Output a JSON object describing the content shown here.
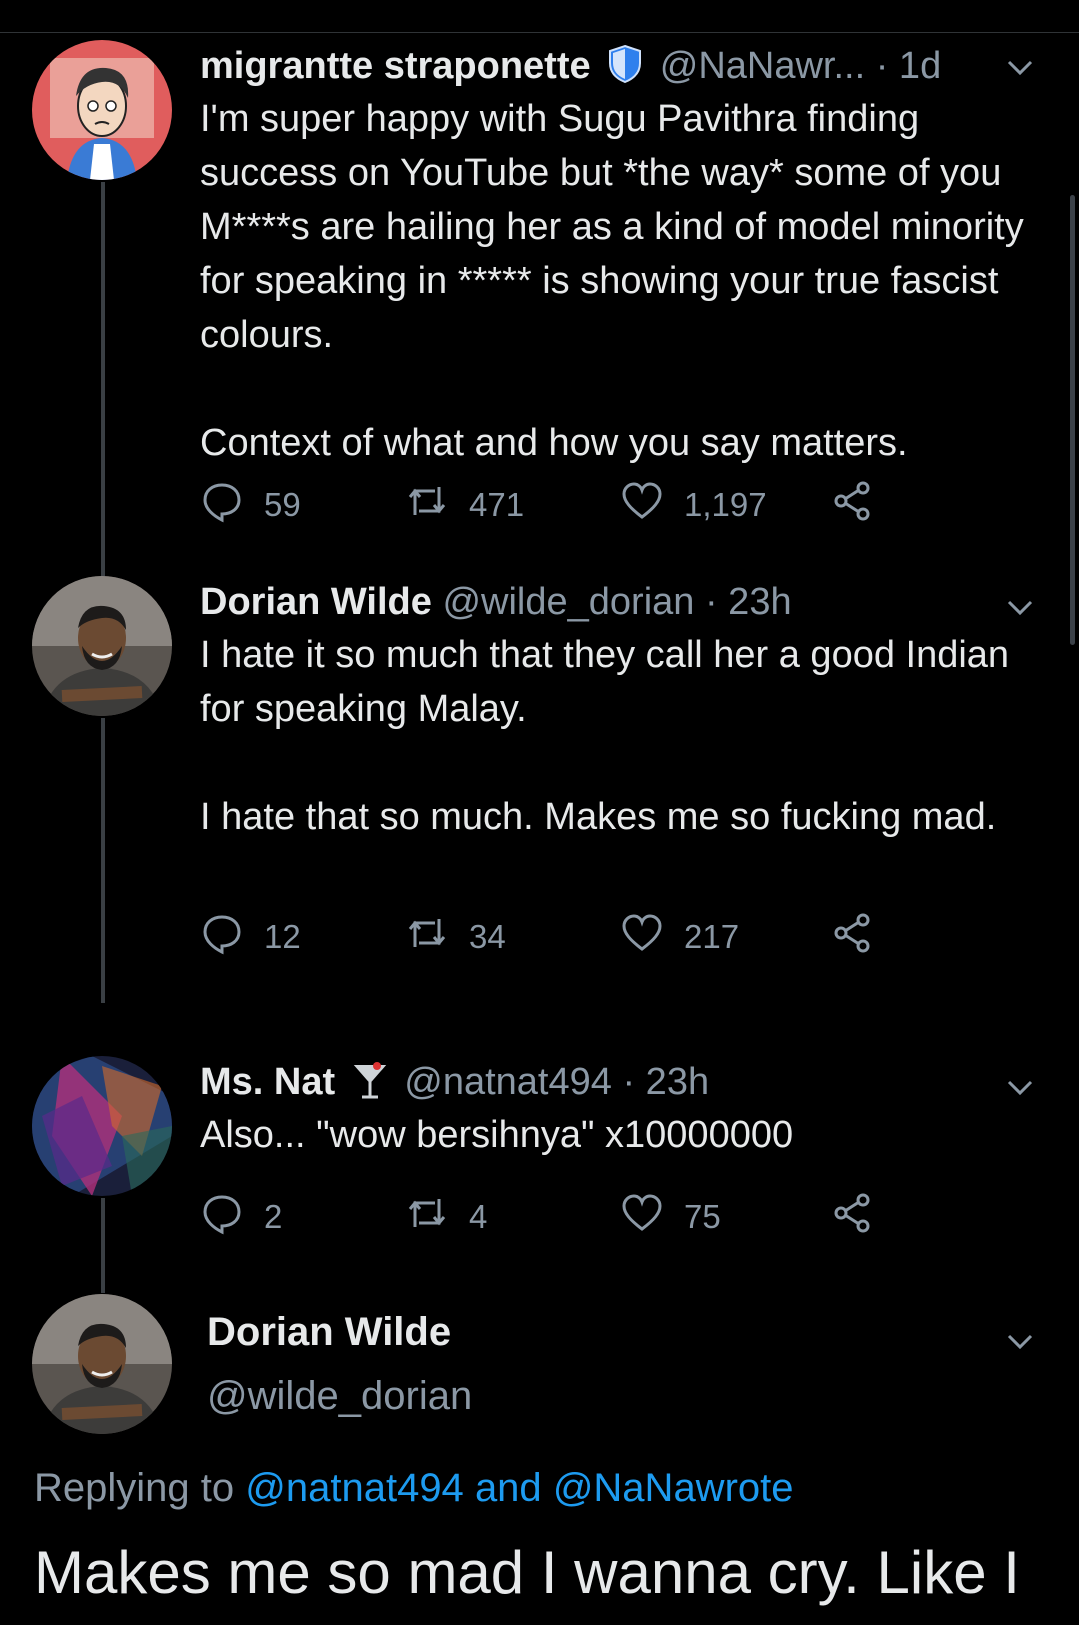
{
  "tweets": [
    {
      "name": "migrantte straponette",
      "handle": "@NaNawr...",
      "time": "· 1d",
      "body": [
        "I'm super happy with Sugu Pavithra finding success on YouTube but *the way* some of you M****s are hailing her as a kind of model minority for speaking in ***** is showing your true fascist colours.",
        "Context of what and how you say matters."
      ],
      "replies": "59",
      "retweets": "471",
      "likes": "1,197"
    },
    {
      "name": "Dorian Wilde",
      "handle": "@wilde_dorian",
      "time": "· 23h",
      "body": [
        "I hate it so much that they call her a good Indian for speaking Malay.",
        "I hate that so much. Makes me so fucking mad."
      ],
      "replies": "12",
      "retweets": "34",
      "likes": "217"
    },
    {
      "name": "Ms. Nat",
      "handle": "@natnat494",
      "time": "· 23h",
      "body": [
        "Also... \"wow bersihnya\" x10000000"
      ],
      "replies": "2",
      "retweets": "4",
      "likes": "75"
    }
  ],
  "focused": {
    "name": "Dorian Wilde",
    "handle": "@wilde_dorian",
    "replying_prefix": "Replying to",
    "reply_to_1": "@natnat494",
    "reply_and": "and",
    "reply_to_2": "@NaNawrote",
    "text": "Makes me so mad I wanna cry. Like I"
  },
  "colors": {
    "background": "#000000",
    "text": "#e7e9ea",
    "muted": "#8b98a5",
    "link": "#1d9bf0",
    "verified_shield": "#2f80ed"
  },
  "icons": [
    "reply-icon",
    "retweet-icon",
    "like-icon",
    "share-icon",
    "chevron-down-icon",
    "shield-icon",
    "cocktail-icon"
  ]
}
